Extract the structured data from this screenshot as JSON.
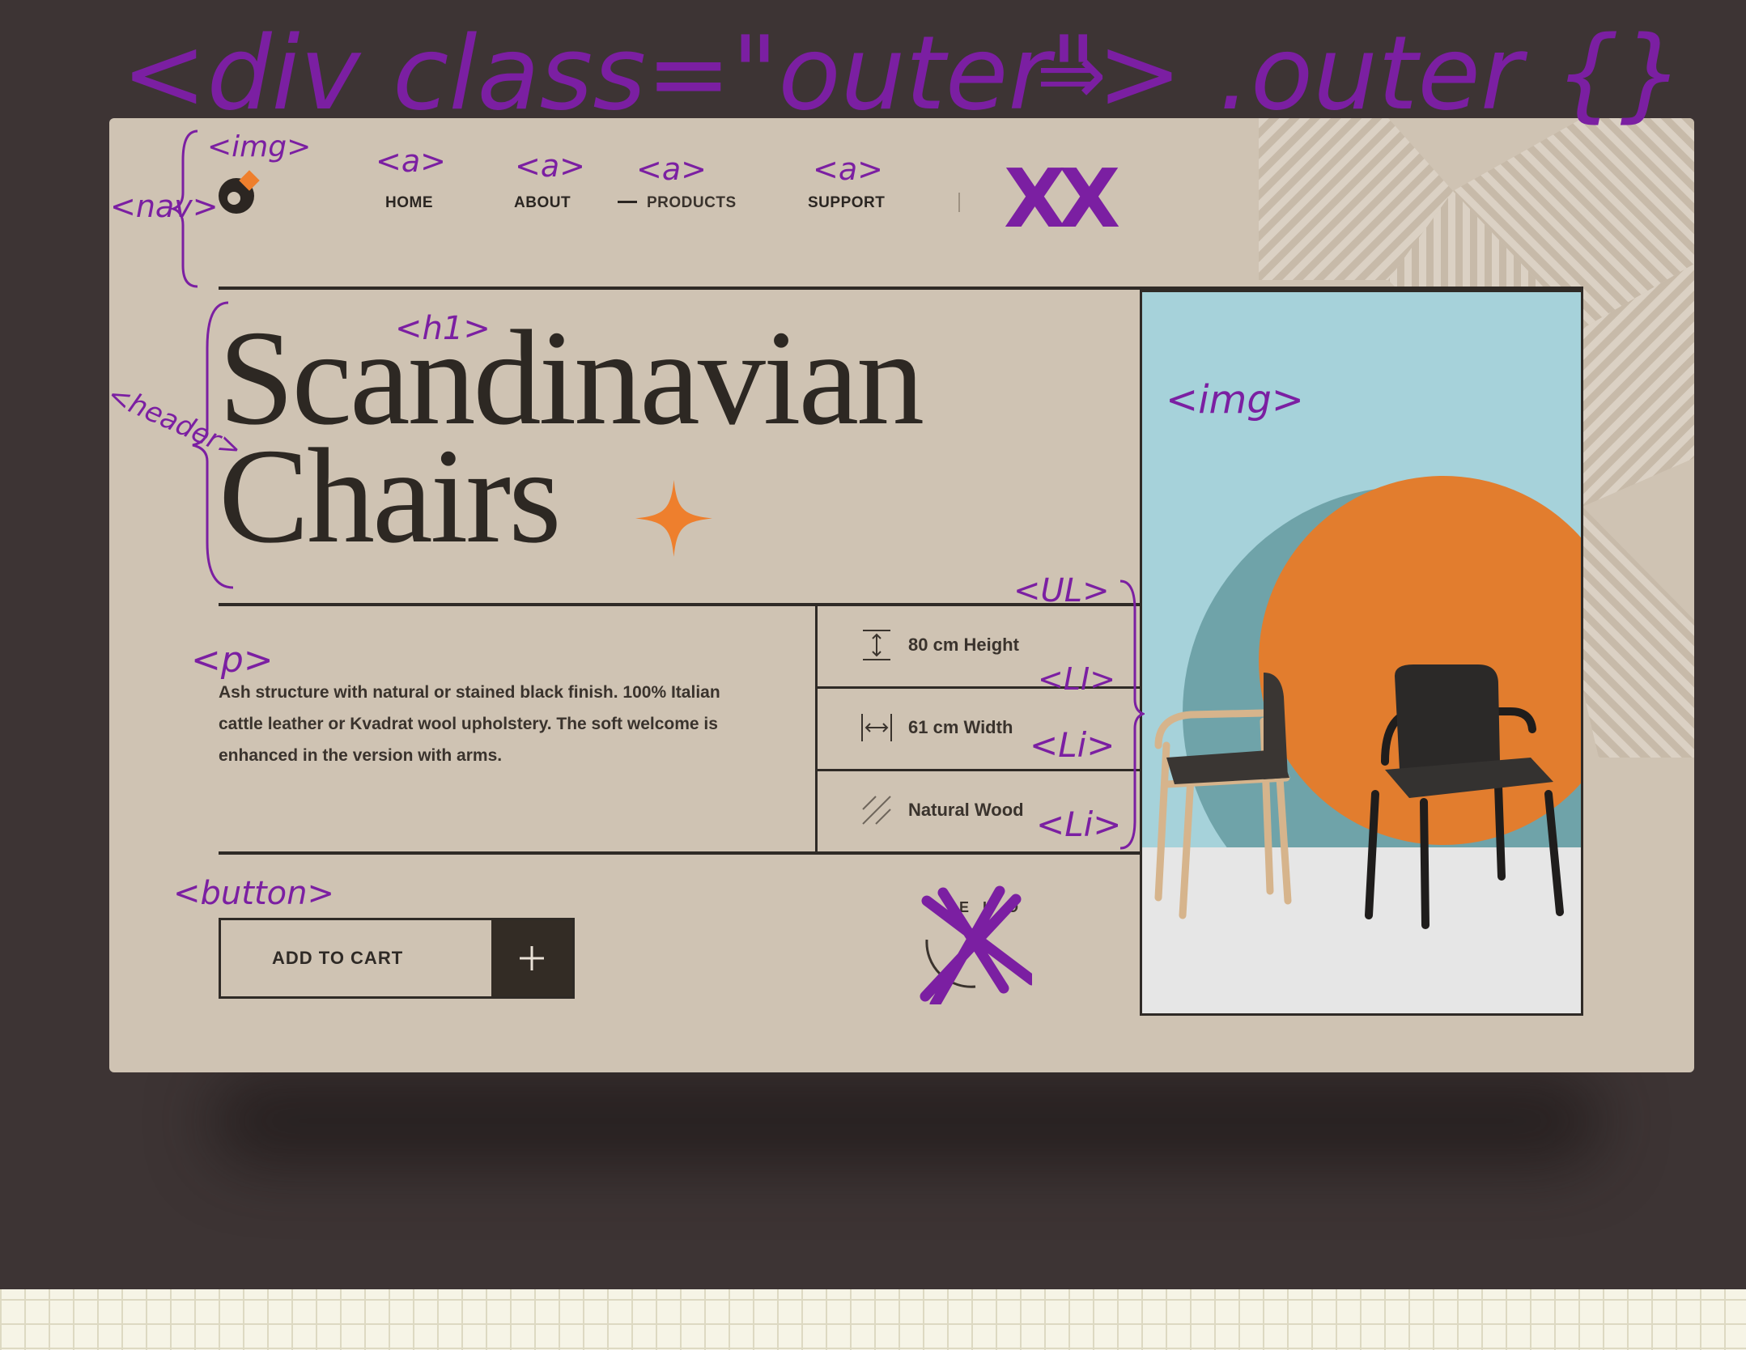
{
  "annotations": {
    "outer_div": "<div class=\"outer\">",
    "arrow": "⇒",
    "outer_css": ".outer {}",
    "nav": "<nav>",
    "logo_img": "<img>",
    "link_tag": "<a>",
    "header": "<header>",
    "h1": "<h1>",
    "hero_img": "<img>",
    "ul": "<UL>",
    "li": "<LI>",
    "li2": "<Li>",
    "li3": "<Li>",
    "p": "<p>",
    "button": "<button>",
    "strike": "XX"
  },
  "nav": {
    "links": [
      {
        "label": "HOME"
      },
      {
        "label": "ABOUT"
      },
      {
        "label": "PRODUCTS"
      },
      {
        "label": "SUPPORT"
      }
    ]
  },
  "hero": {
    "title_line1": "Scandinavian",
    "title_line2": "Chairs",
    "description": "Ash structure with natural or stained black finish. 100% Italian cattle leather or Kvadrat wool upholstery. The soft welcome is enhanced in the version with arms."
  },
  "specs": [
    {
      "label": "80 cm Height",
      "icon": "height-icon"
    },
    {
      "label": "61 cm Width",
      "icon": "width-icon"
    },
    {
      "label": "Natural Wood",
      "icon": "wood-grain-icon"
    }
  ],
  "cart": {
    "label": "ADD TO CART",
    "icon": "plus-icon"
  },
  "colors": {
    "page_bg": "#cfc3b3",
    "ink": "#7b1fa2",
    "accent_orange": "#ee7f2d",
    "dark": "#2f2a26",
    "photo_sky": "#a6d2da"
  }
}
